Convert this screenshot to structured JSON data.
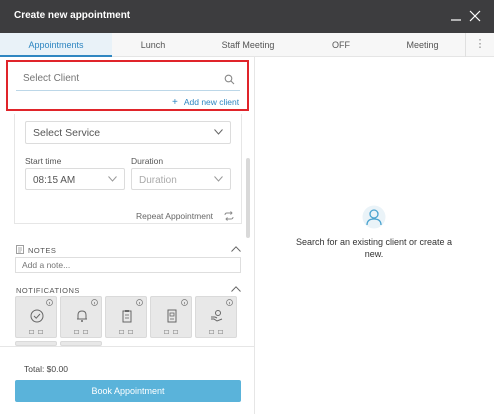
{
  "window": {
    "title": "Create new appointment"
  },
  "tabs": [
    {
      "label": "Appointments"
    },
    {
      "label": "Lunch"
    },
    {
      "label": "Staff Meeting"
    },
    {
      "label": "OFF"
    },
    {
      "label": "Meeting"
    }
  ],
  "client": {
    "placeholder": "Select Client",
    "add_label": "Add new client",
    "add_symbol": "+"
  },
  "service": {
    "placeholder": "Select Service"
  },
  "start_time": {
    "label": "Start time",
    "value": "08:15 AM"
  },
  "duration": {
    "label": "Duration",
    "placeholder": "Duration"
  },
  "repeat": {
    "label": "Repeat Appointment"
  },
  "notes": {
    "heading": "NOTES",
    "placeholder": "Add a note..."
  },
  "notifications": {
    "heading": "NOTIFICATIONS"
  },
  "footer": {
    "total": "Total: $0.00",
    "book_label": "Book Appointment"
  },
  "empty_state": {
    "message": "Search for an existing client or create a new."
  },
  "colors": {
    "accent": "#2e86c1",
    "button": "#5ab3da",
    "highlight": "#e0242a",
    "titlebar": "#3d3d3f"
  }
}
